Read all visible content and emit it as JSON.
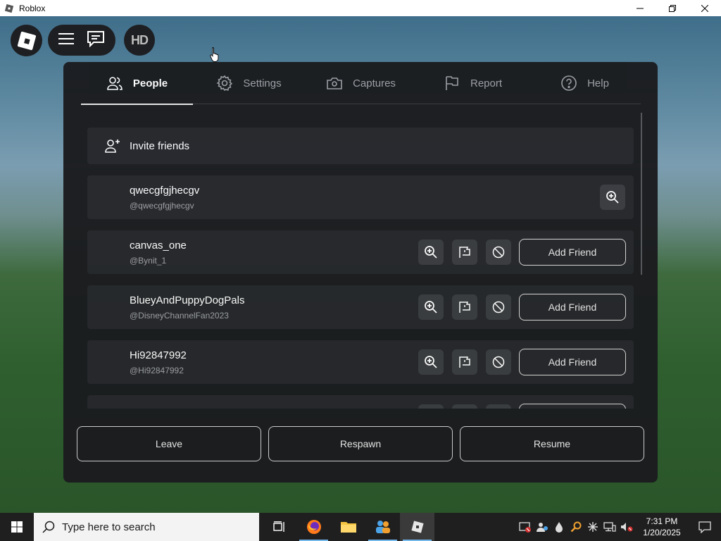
{
  "window": {
    "title": "Roblox"
  },
  "topbar": {
    "avatar_initials": "HD"
  },
  "tabs": [
    {
      "label": "People",
      "icon": "people-icon"
    },
    {
      "label": "Settings",
      "icon": "gear-icon"
    },
    {
      "label": "Captures",
      "icon": "camera-icon"
    },
    {
      "label": "Report",
      "icon": "flag-icon"
    },
    {
      "label": "Help",
      "icon": "help-icon"
    }
  ],
  "people": {
    "invite_label": "Invite friends",
    "players": [
      {
        "name": "qwecgfgjhecgv",
        "handle": "@qwecgfgjhecgv"
      },
      {
        "name": "canvas_one",
        "handle": "@Bynit_1",
        "action": "Add Friend"
      },
      {
        "name": "BlueyAndPuppyDogPals",
        "handle": "@DisneyChannelFan2023",
        "action": "Add Friend"
      },
      {
        "name": "Hi92847992",
        "handle": "@Hi92847992",
        "action": "Add Friend"
      }
    ]
  },
  "actions": {
    "leave": "Leave",
    "respawn": "Respawn",
    "resume": "Resume"
  },
  "taskbar": {
    "search_placeholder": "Type here to search",
    "time": "7:31 PM",
    "date": "1/20/2025"
  },
  "colors": {
    "panel_bg": "#1b1c1f",
    "row_bg": "#26272b",
    "taskbar_bg": "#1f1f1f"
  }
}
